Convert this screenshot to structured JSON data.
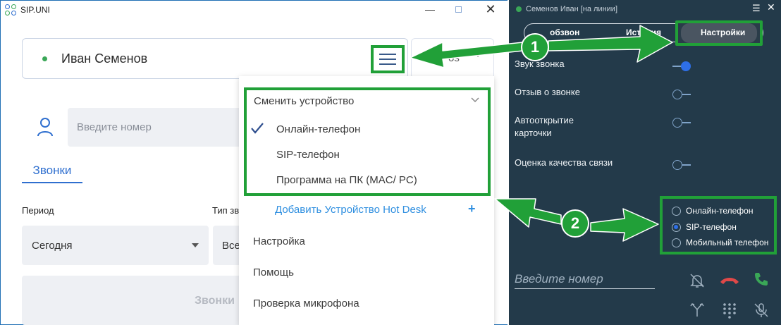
{
  "left_window": {
    "title": "SIP.UNI",
    "minimize": "—",
    "close": "✕",
    "user_name": "Иван Семенов",
    "device_partial": "os",
    "phone_input_placeholder": "Введите номер",
    "tab_calls": "Звонки",
    "period_label": "Период",
    "type_label": "Тип звонка",
    "period_value": "Сегодня",
    "type_value": "Все",
    "calls_button": "Звонки"
  },
  "dropdown": {
    "change_device": "Сменить устройство",
    "devices": [
      {
        "label": "Онлайн-телефон",
        "selected": true
      },
      {
        "label": "SIP-телефон",
        "selected": false
      },
      {
        "label": "Программа на ПК (MAC/ PC)",
        "selected": false
      }
    ],
    "add_hot_desk": "Добавить Устройство Hot Desk",
    "plus": "+",
    "settings": "Настройка",
    "help": "Помощь",
    "mic_check": "Проверка микрофона"
  },
  "softphone": {
    "title": "Семенов Иван [на линии]",
    "menu_glyph": "☰",
    "close_glyph": "✕",
    "tabs": [
      "обзвон",
      "История",
      "Настройки"
    ],
    "active_tab": "Настройки",
    "settings": [
      {
        "label": "Звук звонка",
        "on": true
      },
      {
        "label": "Отзыв о звонке",
        "on": false
      },
      {
        "label": "Автооткрытие карточки",
        "on": false
      },
      {
        "label": "Оценка качества связи",
        "on": false
      }
    ],
    "phone_types": [
      {
        "label": "Онлайн-телефон",
        "selected": false
      },
      {
        "label": "SIP-телефон",
        "selected": true
      },
      {
        "label": "Мобильный телефон",
        "selected": false
      }
    ],
    "input_placeholder": "Введите номер"
  },
  "annotations": {
    "badge_1": "1",
    "badge_2": "2"
  },
  "colors": {
    "annotation_green": "#21a038",
    "softphone_bg": "#233a4a",
    "accent_blue": "#2f6fcf",
    "hangup_red": "#e04848",
    "call_green": "#3aa757"
  }
}
